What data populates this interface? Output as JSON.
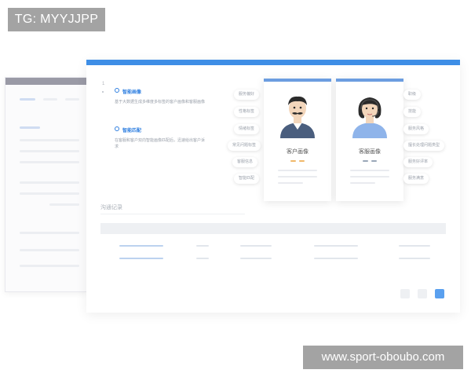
{
  "watermark": {
    "top_label": "TG: MYYJJPP",
    "bottom_label": "www.sport-oboubo.com"
  },
  "features": [
    {
      "title": "智能画像",
      "icon": "user-circle-icon",
      "desc": "基于大数据生成多维度多标签的客户画像和客服画像"
    },
    {
      "title": "智能匹配",
      "icon": "match-circle-icon",
      "desc": "在客服和客户双向智能画像匹配后，迅速给出客户诉求"
    }
  ],
  "numbering": {
    "first": "1"
  },
  "left_tags": [
    "服务偏好",
    "性格标签",
    "情绪标签",
    "常见问题标签",
    "客服信息",
    "智能匹配"
  ],
  "right_tags": [
    "职级",
    "技能",
    "服务风格",
    "擅长处理问题类型",
    "服务好评率",
    "服务满意"
  ],
  "cards": {
    "customer": {
      "title": "客户画像",
      "avatar": "male-avatar-icon"
    },
    "agent": {
      "title": "客服画像",
      "avatar": "female-agent-avatar-icon"
    }
  },
  "section": {
    "label": "沟通记录"
  },
  "colors": {
    "accent": "#3e8ee6",
    "tag_gray": "#a3a3a3",
    "card_accent": "#6c9de0",
    "dash_orange": "#f0b86a",
    "dash_gray": "#9aa7b8"
  }
}
